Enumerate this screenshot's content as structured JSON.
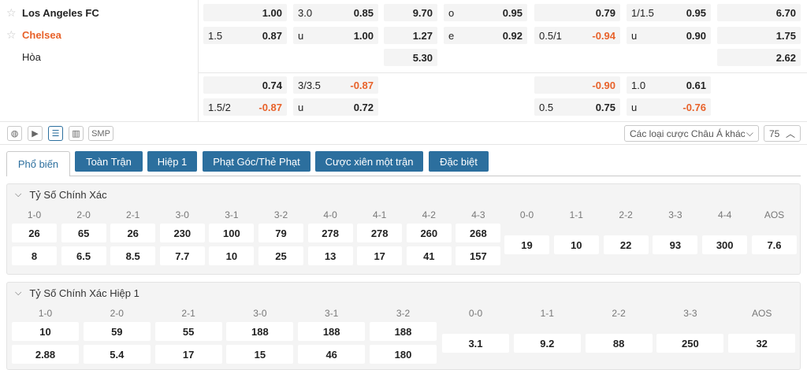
{
  "teams": {
    "home": "Los Angeles FC",
    "away": "Chelsea",
    "draw": "Hòa"
  },
  "odds_row1": [
    {
      "l": "",
      "v": "1.00",
      "neg": false
    },
    {
      "l": "3.0",
      "v": "0.85",
      "neg": false
    },
    {
      "l": "",
      "v": "9.70",
      "neg": false
    },
    {
      "l": "o",
      "v": "0.95",
      "neg": false
    },
    {
      "l": "",
      "v": "0.79",
      "neg": false
    },
    {
      "l": "1/1.5",
      "v": "0.95",
      "neg": false
    },
    {
      "l": "",
      "v": "6.70",
      "neg": false
    }
  ],
  "odds_row2": [
    {
      "l": "1.5",
      "v": "0.87",
      "neg": false
    },
    {
      "l": "u",
      "v": "1.00",
      "neg": false
    },
    {
      "l": "",
      "v": "1.27",
      "neg": false
    },
    {
      "l": "e",
      "v": "0.92",
      "neg": false
    },
    {
      "l": "0.5/1",
      "v": "-0.94",
      "neg": true
    },
    {
      "l": "u",
      "v": "0.90",
      "neg": false
    },
    {
      "l": "",
      "v": "1.75",
      "neg": false
    }
  ],
  "odds_row3": [
    {
      "l": "",
      "v": "5.30",
      "neg": false
    },
    {
      "l": "",
      "v": "2.62",
      "neg": false
    }
  ],
  "odds_row4": [
    {
      "l": "",
      "v": "0.74",
      "neg": false
    },
    {
      "l": "3/3.5",
      "v": "-0.87",
      "neg": true
    },
    {
      "l": "",
      "v": "-0.90",
      "neg": true
    },
    {
      "l": "1.0",
      "v": "0.61",
      "neg": false
    }
  ],
  "odds_row5": [
    {
      "l": "1.5/2",
      "v": "-0.87",
      "neg": true
    },
    {
      "l": "u",
      "v": "0.72",
      "neg": false
    },
    {
      "l": "0.5",
      "v": "0.75",
      "neg": false
    },
    {
      "l": "u",
      "v": "-0.76",
      "neg": true
    }
  ],
  "toolbar": {
    "smp": "SMP",
    "market_select": "Các loại cược Châu Á khác",
    "count": "75"
  },
  "tabs": [
    "Phổ biến",
    "Toàn Trận",
    "Hiệp 1",
    "Phạt Góc/Thẻ Phạt",
    "Cược xiên một trận",
    "Đặc biệt"
  ],
  "section1": {
    "title": "Tỷ Số Chính Xác",
    "left": [
      {
        "label": "1-0",
        "home": "26",
        "away": "8"
      },
      {
        "label": "2-0",
        "home": "65",
        "away": "6.5"
      },
      {
        "label": "2-1",
        "home": "26",
        "away": "8.5"
      },
      {
        "label": "3-0",
        "home": "230",
        "away": "7.7"
      },
      {
        "label": "3-1",
        "home": "100",
        "away": "10"
      },
      {
        "label": "3-2",
        "home": "79",
        "away": "25"
      },
      {
        "label": "4-0",
        "home": "278",
        "away": "13"
      },
      {
        "label": "4-1",
        "home": "278",
        "away": "17"
      },
      {
        "label": "4-2",
        "home": "260",
        "away": "41"
      },
      {
        "label": "4-3",
        "home": "268",
        "away": "157"
      }
    ],
    "right": [
      {
        "label": "0-0",
        "v": "19"
      },
      {
        "label": "1-1",
        "v": "10"
      },
      {
        "label": "2-2",
        "v": "22"
      },
      {
        "label": "3-3",
        "v": "93"
      },
      {
        "label": "4-4",
        "v": "300"
      },
      {
        "label": "AOS",
        "v": "7.6"
      }
    ]
  },
  "section2": {
    "title": "Tỷ Số Chính Xác Hiệp 1",
    "left": [
      {
        "label": "1-0",
        "home": "10",
        "away": "2.88"
      },
      {
        "label": "2-0",
        "home": "59",
        "away": "5.4"
      },
      {
        "label": "2-1",
        "home": "55",
        "away": "17"
      },
      {
        "label": "3-0",
        "home": "188",
        "away": "15"
      },
      {
        "label": "3-1",
        "home": "188",
        "away": "46"
      },
      {
        "label": "3-2",
        "home": "188",
        "away": "180"
      }
    ],
    "right": [
      {
        "label": "0-0",
        "v": "3.1"
      },
      {
        "label": "1-1",
        "v": "9.2"
      },
      {
        "label": "2-2",
        "v": "88"
      },
      {
        "label": "3-3",
        "v": "250"
      },
      {
        "label": "AOS",
        "v": "32"
      }
    ]
  }
}
